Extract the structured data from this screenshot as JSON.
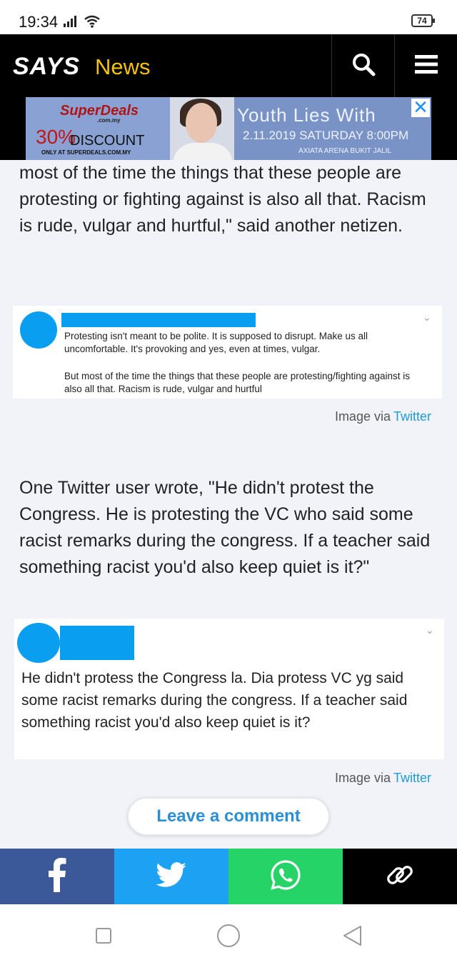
{
  "status_bar": {
    "time": "19:34",
    "battery": "74"
  },
  "header": {
    "logo": "SAYS",
    "section": "News"
  },
  "ad": {
    "brand": "SuperDeals",
    "brand_sub": ".com.my",
    "discount_percent": "30%",
    "discount_label": "DISCOUNT",
    "only_at": "ONLY AT SUPERDEALS.COM.MY",
    "event_title": "Youth Lies With",
    "event_date": "2.11.2019 SATURDAY 8:00PM",
    "event_venue": "AXIATA ARENA BUKIT JALIL",
    "close_symbol": "✕"
  },
  "article": {
    "para1": "most of the time the things that these people are protesting or fighting against is also all that. Racism is rude, vulgar and hurtful,\" said another netizen.",
    "tweet1": {
      "text1": "Protesting isn't meant to be polite. It is supposed to disrupt. Make us all uncomfortable. It's provoking and yes, even at times, vulgar.",
      "text2": "But most of the time the things that these people are protesting/fighting against is also all that. Racism is rude, vulgar and hurtful"
    },
    "credit1": {
      "label": "Image via",
      "source": "Twitter"
    },
    "para2": "One Twitter user wrote, \"He didn't protest the Congress. He is protesting the VC who said some racist remarks during the congress. If a teacher said something racist you'd also keep quiet is it?\"",
    "tweet2": {
      "text": "He didn't protess the Congress la. Dia protess VC yg said some racist remarks during the congress. If a teacher said something racist you'd also keep quiet is it?"
    },
    "credit2": {
      "label": "Image via",
      "source": "Twitter"
    }
  },
  "leave_comment": "Leave a comment",
  "share": {
    "colors": {
      "facebook": "#3b5998",
      "twitter": "#1da1f2",
      "whatsapp": "#25d366",
      "link": "#000000"
    },
    "icons": [
      "facebook-icon",
      "twitter-icon",
      "whatsapp-icon",
      "link-icon"
    ]
  },
  "colors": {
    "header_bg": "#000000",
    "section_accent": "#f5c400",
    "link": "#1d9bd6"
  }
}
